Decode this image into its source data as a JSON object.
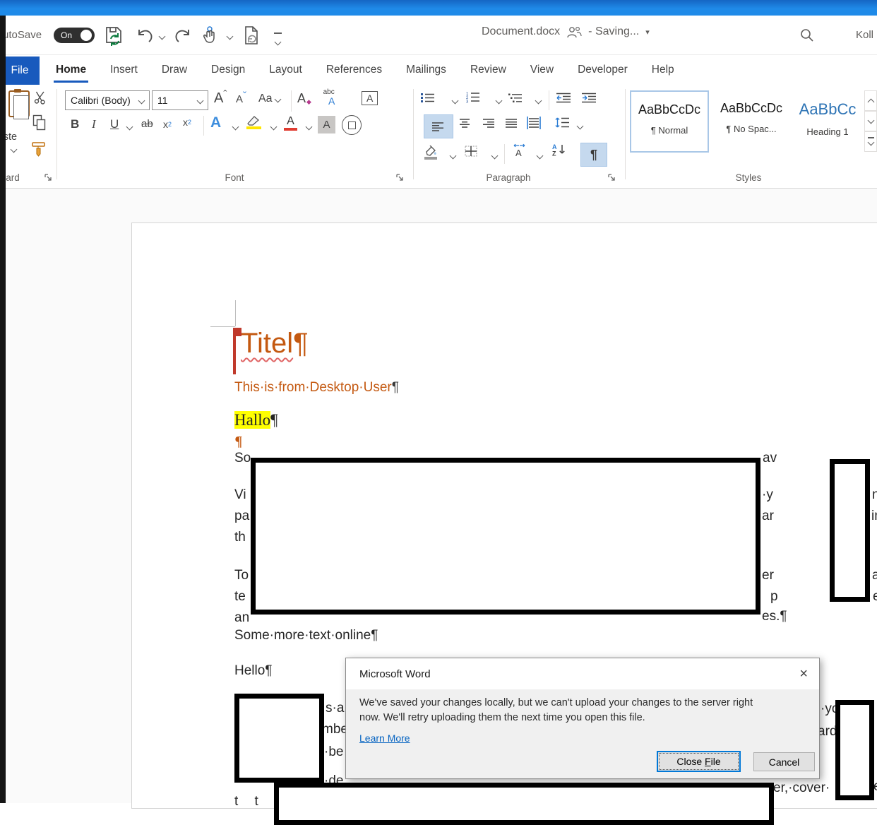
{
  "titlebar": {
    "autosave": "AutoSave",
    "autosave_state": "On",
    "doc_title": "Document.docx",
    "status": "- Saving...",
    "account": "Koll"
  },
  "tabs": {
    "file": "File",
    "items": [
      "Home",
      "Insert",
      "Draw",
      "Design",
      "Layout",
      "References",
      "Mailings",
      "Review",
      "View",
      "Developer",
      "Help"
    ]
  },
  "ribbon": {
    "clipboard": {
      "paste": "Paste",
      "label": "Clipboard"
    },
    "font": {
      "name": "Calibri (Body)",
      "size": "11",
      "label": "Font"
    },
    "paragraph": {
      "label": "Paragraph"
    },
    "styles": {
      "label": "Styles",
      "cards": [
        {
          "preview": "AaBbCcDc",
          "label": "¶ Normal"
        },
        {
          "preview": "AaBbCcDc",
          "label": "¶ No Spac..."
        },
        {
          "preview": "AaBbCc",
          "label": "Heading 1"
        }
      ]
    }
  },
  "glyphs": {
    "bold": "B",
    "italic": "I",
    "underline": "U",
    "strikethrough": "ab",
    "sub_base": "x",
    "sub_s": "2",
    "sup_base": "x",
    "sup_s": "2",
    "grow": "A",
    "caret_up": "ˆ",
    "shrink": "A",
    "caret_down": "ˇ",
    "change_case": "Aa",
    "clear_format": "A",
    "clear_mark": "◆",
    "phonetic_top": "abc",
    "phonetic_base": "A",
    "char_border": "A",
    "text_effects": "A",
    "font_color": "A",
    "char_shade": "A",
    "num1": "1",
    "num2": "2",
    "num3": "3",
    "sort_a": "A",
    "sort_z": "Z",
    "asian_a": "A",
    "pilcrow": "¶",
    "triangle_down": "▾"
  },
  "document": {
    "title": "Titel",
    "title_mark": "¶",
    "subtitle": "This·is·from·Desktop·User",
    "subtitle_mark": "¶",
    "hallo": "Hallo",
    "hallo_mark": "¶",
    "lone_mark": "¶",
    "some_more": "Some·more·text·online",
    "some_more_mark": "¶",
    "hello": "Hello",
    "hello_mark": "¶",
    "fragments": {
      "so": "So",
      "vi": "Vi",
      "pa": "pa",
      "th": "th",
      "to": "To",
      "te": "te",
      "an": "an",
      "av": "av",
      "y": "·y",
      "ar": "ar",
      "er": "er",
      "p": "p",
      "es": "es.",
      "es_mark": "¶",
      "n": "n",
      "in_": "in",
      "a": "a",
      "e": "e",
      "sa": "s·a·",
      "mbe": "mbe",
      "be": "·be",
      "de": "·de",
      "yo": "·yo",
      "ard": "ard",
      "er_cover": "er,·cover·",
      "e2": "e",
      "bottom_clip": "t t l l i"
    }
  },
  "dialog": {
    "title": "Microsoft Word",
    "close_x": "×",
    "message1": "We've saved your changes locally, but we can't upload your changes to the server right",
    "message2": "now. We'll retry uploading them the next time you open this file.",
    "link": "Learn More",
    "btn_close_pre": "Close ",
    "btn_close_accel": "F",
    "btn_close_post": "ile",
    "btn_cancel": "Cancel"
  }
}
